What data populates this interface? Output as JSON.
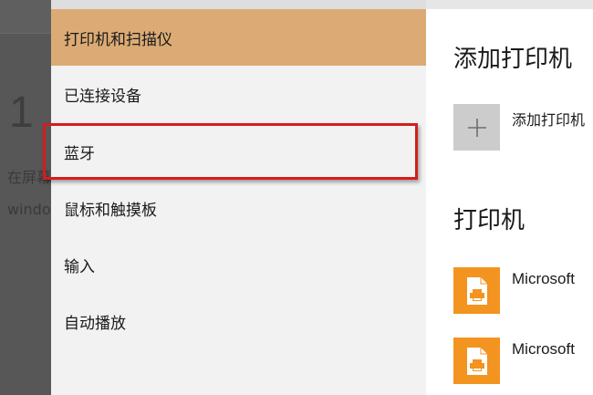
{
  "background_article": {
    "heading_number": "1",
    "line1": "在屏幕",
    "line2": "windo"
  },
  "sidebar": {
    "items": [
      {
        "label": "打印机和扫描仪",
        "selected": true
      },
      {
        "label": "已连接设备",
        "selected": false
      },
      {
        "label": "蓝牙",
        "selected": false
      },
      {
        "label": "鼠标和触摸板",
        "selected": false
      },
      {
        "label": "输入",
        "selected": false
      },
      {
        "label": "自动播放",
        "selected": false
      }
    ],
    "selected_color": "#dcab75",
    "annotation_color": "#d41d1d"
  },
  "main": {
    "add_section_title": "添加打印机",
    "add_button_label": "添加打印机",
    "printers_section_title": "打印机",
    "printers": [
      {
        "name": "Microsoft"
      },
      {
        "name": "Microsoft"
      }
    ],
    "printer_icon_color": "#f2941f"
  }
}
